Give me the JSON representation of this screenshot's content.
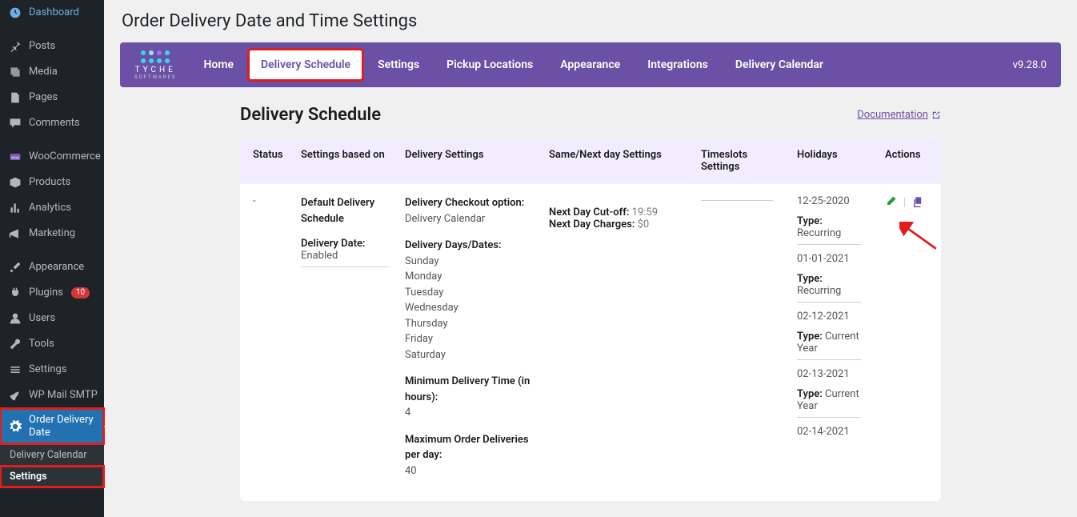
{
  "sidebar": {
    "items": [
      {
        "label": "Dashboard"
      },
      {
        "label": "Posts"
      },
      {
        "label": "Media"
      },
      {
        "label": "Pages"
      },
      {
        "label": "Comments"
      },
      {
        "label": "WooCommerce"
      },
      {
        "label": "Products"
      },
      {
        "label": "Analytics"
      },
      {
        "label": "Marketing"
      },
      {
        "label": "Appearance"
      },
      {
        "label": "Plugins",
        "badge": "10"
      },
      {
        "label": "Users"
      },
      {
        "label": "Tools"
      },
      {
        "label": "Settings"
      },
      {
        "label": "WP Mail SMTP"
      },
      {
        "label": "Order Delivery Date"
      }
    ],
    "sub": [
      {
        "label": "Delivery Calendar"
      },
      {
        "label": "Settings"
      }
    ]
  },
  "page_title": "Order Delivery Date and Time Settings",
  "topbar": {
    "logo_text": "TYCHE",
    "logo_sub": "SOFTWARES",
    "tabs": [
      {
        "label": "Home"
      },
      {
        "label": "Delivery Schedule"
      },
      {
        "label": "Settings"
      },
      {
        "label": "Pickup Locations"
      },
      {
        "label": "Appearance"
      },
      {
        "label": "Integrations"
      },
      {
        "label": "Delivery Calendar"
      }
    ],
    "version": "v9.28.0"
  },
  "section": {
    "title": "Delivery Schedule",
    "doc_link": "Documentation"
  },
  "table": {
    "headers": [
      "Status",
      "Settings based on",
      "Delivery Settings",
      "Same/Next day Settings",
      "Timeslots Settings",
      "Holidays",
      "Actions"
    ],
    "row": {
      "status": "-",
      "settings_based_on": {
        "name": "Default Delivery Schedule",
        "date_key": "Delivery Date:",
        "date_val": "Enabled"
      },
      "delivery": {
        "checkout_key": "Delivery Checkout option:",
        "checkout_val": "Delivery Calendar",
        "days_key": "Delivery Days/Dates:",
        "days": [
          "Sunday",
          "Monday",
          "Tuesday",
          "Wednesday",
          "Thursday",
          "Friday",
          "Saturday"
        ],
        "min_key": "Minimum Delivery Time (in hours):",
        "min_val": "4",
        "max_key": "Maximum Order Deliveries per day:",
        "max_val": "40"
      },
      "same_next": {
        "cutoff_key": "Next Day Cut-off:",
        "cutoff_val": "19:59",
        "charges_key": "Next Day Charges:",
        "charges_val": "$0"
      },
      "timeslots": "",
      "holidays": {
        "type_label": "Type:",
        "recurring_label": "Recurring",
        "current_year_label": "Current Year",
        "items": [
          {
            "date": "12-25-2020",
            "type": "Recurring"
          },
          {
            "date": "01-01-2021",
            "type": "Recurring"
          },
          {
            "date": "02-12-2021",
            "type": "Current Year"
          },
          {
            "date": "02-13-2021",
            "type": "Current Year"
          },
          {
            "date": "02-14-2021",
            "type": ""
          }
        ]
      }
    }
  }
}
